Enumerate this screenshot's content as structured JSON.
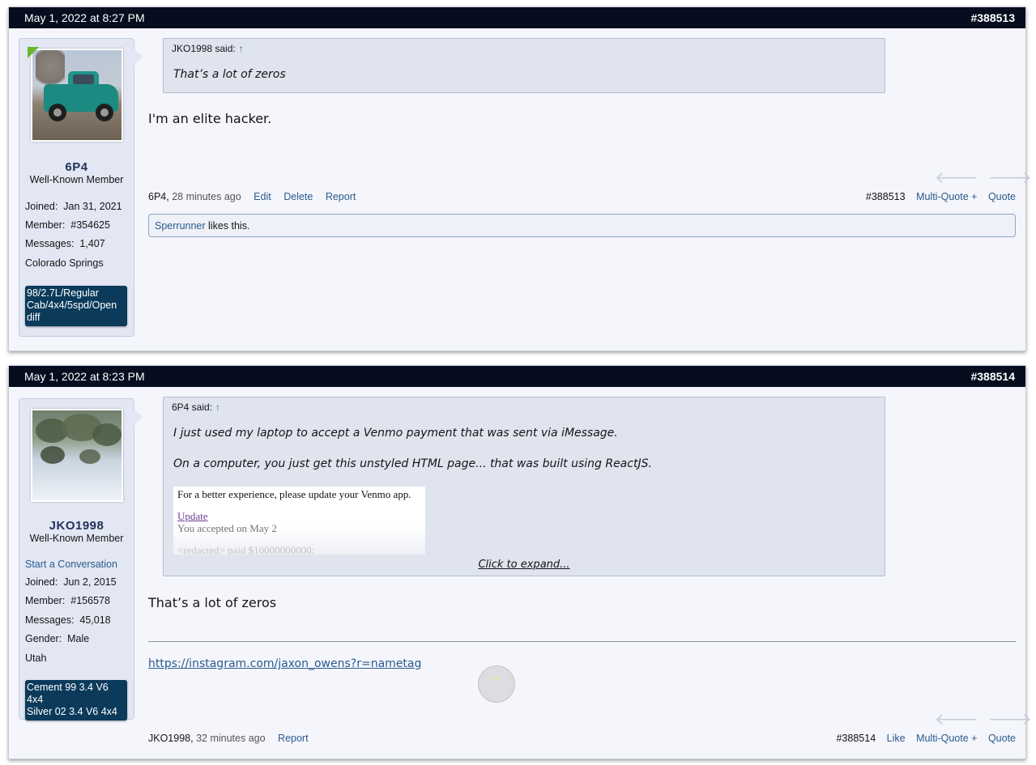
{
  "posts": [
    {
      "date": "May 1, 2022 at 8:27 PM",
      "number": "#388513",
      "user": {
        "name": "6P4",
        "title": "Well-Known Member",
        "joined_label": "Joined:",
        "joined": "Jan 31, 2021",
        "member_label": "Member:",
        "member": "#354625",
        "messages_label": "Messages:",
        "messages": "1,407",
        "location": "Colorado Springs",
        "banner": "98/2.7L/Regular Cab/4x4/5spd/Open diff",
        "online": true,
        "avatar_icon": "truck-avatar"
      },
      "quote": {
        "author": "JKO1998 said:",
        "arrow": "↑",
        "lines": [
          "That’s a lot of zeros"
        ]
      },
      "message": "I'm an elite hacker.",
      "footer": {
        "author": "6P4",
        "time": "28 minutes ago",
        "actions": [
          "Edit",
          "Delete",
          "Report"
        ],
        "post_id": "#388513",
        "right_actions": [
          "Multi-Quote +",
          "Quote"
        ]
      },
      "likes": {
        "who": "Sperrunner",
        "text": "likes this."
      }
    },
    {
      "date": "May 1, 2022 at 8:23 PM",
      "number": "#388514",
      "user": {
        "name": "JKO1998",
        "title": "Well-Known Member",
        "start_conversation": "Start a Conversation",
        "joined_label": "Joined:",
        "joined": "Jun 2, 2015",
        "member_label": "Member:",
        "member": "#156578",
        "messages_label": "Messages:",
        "messages": "45,018",
        "gender_label": "Gender:",
        "gender": "Male",
        "location": "Utah",
        "banner_line1": "Cement 99 3.4 V6 4x4",
        "banner_line2": "Silver 02 3.4 V6 4x4",
        "avatar_icon": "snow-landscape-avatar"
      },
      "quote": {
        "author": "6P4 said:",
        "arrow": "↑",
        "lines": [
          "I just used my laptop to accept a Venmo payment that was sent via iMessage.",
          "On a computer, you just get this unstyled HTML page... that was built using ReactJS."
        ],
        "image_lines": {
          "l1": "For a better experience, please update your Venmo app.",
          "update": "Update",
          "accepted": "You accepted on May 2",
          "redacted": "<redacted> paid $10000000000:"
        },
        "expand": "Click to expand..."
      },
      "message": "That’s a lot of zeros",
      "signature": "https://instagram.com/jaxon_owens?r=nametag",
      "footer": {
        "author": "JKO1998",
        "time": "32 minutes ago",
        "actions": [
          "Report"
        ],
        "post_id": "#388514",
        "right_actions": [
          "Like",
          "Multi-Quote +",
          "Quote"
        ]
      }
    }
  ],
  "nav": {
    "prev_icon": "arrow-left-icon",
    "next_icon": "arrow-right-icon",
    "prev": "🡐",
    "next": "🡒"
  },
  "scroll_top": {
    "icon": "chevron-up-icon",
    "glyph": "⌃"
  },
  "colors": {
    "header_bg": "#050d1e",
    "link": "#2b5a8c",
    "banner_bg": "#0b3a5b",
    "post_bg": "#f4f6fc",
    "online": "#68b42c"
  }
}
